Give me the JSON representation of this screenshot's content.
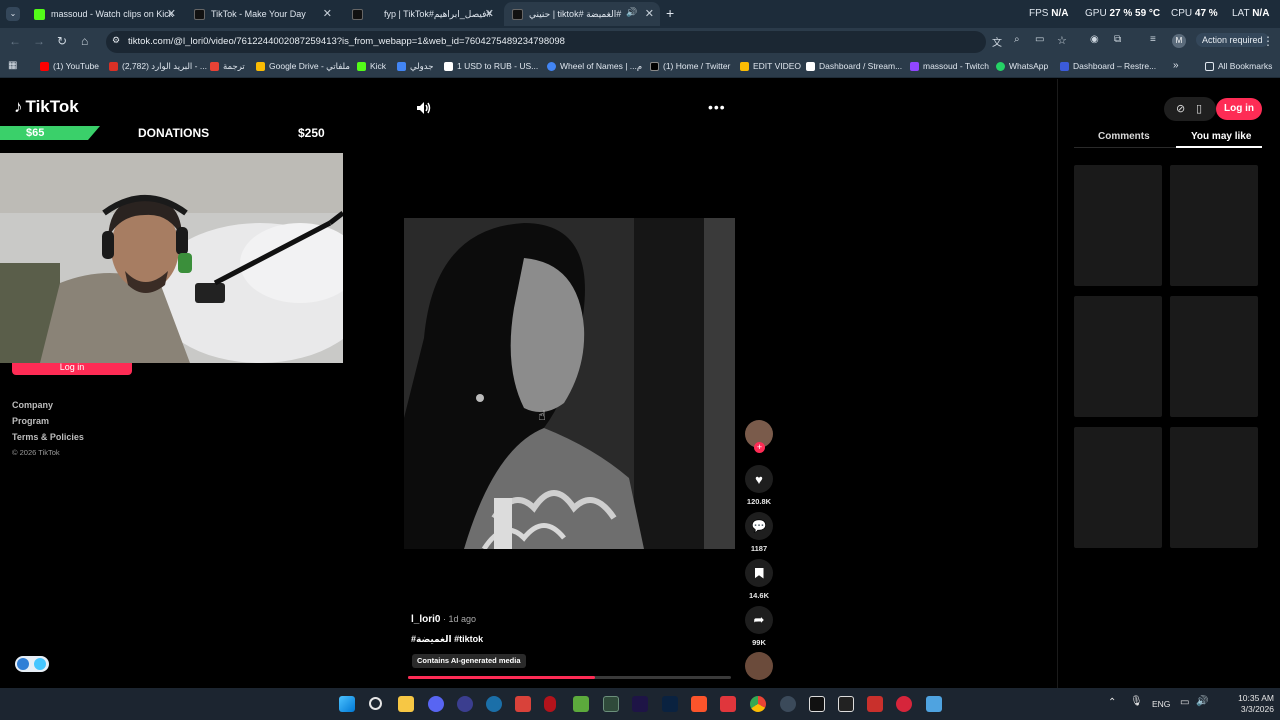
{
  "browser": {
    "tabs": [
      {
        "title": "massoud - Watch clips on Kick",
        "color": "#53fc18"
      },
      {
        "title": "TikTok - Make Your Day",
        "color": "#111111"
      },
      {
        "title": "",
        "color": "#111111"
      },
      {
        "title": "fyp | TikTok#فيصل_ابراهيم#",
        "color": "#111111"
      },
      {
        "title": "حنيني | tiktok# الغميضة#",
        "color": "#111111"
      }
    ],
    "new_tab": "+",
    "stats": {
      "fps_label": "FPS",
      "fps_value": "N/A",
      "gpu_label": "GPU",
      "gpu_value": "27 % 59 °C",
      "cpu_label": "CPU",
      "cpu_value": "47 %",
      "lat_label": "LAT",
      "lat_value": "N/A"
    },
    "url": "tiktok.com/@l_lori0/video/7612244002087259413?is_from_webapp=1&web_id=7604275489234798098",
    "action_required": "Action required",
    "bookmarks": [
      {
        "label": "(1) YouTube",
        "color": "#ff0000"
      },
      {
        "label": "(2,782) البريد الوارد - ...",
        "color": "#d93025"
      },
      {
        "label": "ترجمة",
        "color": "#e94235"
      },
      {
        "label": "Google Drive - ملفاتي",
        "color": "#fbbc04"
      },
      {
        "label": "Kick",
        "color": "#53fc18"
      },
      {
        "label": "جدولي",
        "color": "#4285f4"
      },
      {
        "label": "1 USD to RUB - US...",
        "color": "#ffffff"
      },
      {
        "label": "Wheel of Names | ...م",
        "color": "#4285f4"
      },
      {
        "label": "(1) Home / Twitter",
        "color": "#000000"
      },
      {
        "label": "EDIT VIDEO",
        "color": "#fbbc04"
      },
      {
        "label": "Dashboard / Stream...",
        "color": "#ffffff"
      },
      {
        "label": "massoud - Twitch",
        "color": "#9146ff"
      },
      {
        "label": "WhatsApp",
        "color": "#25d366"
      },
      {
        "label": "Dashboard – Restre...",
        "color": "#3b5bdb"
      }
    ],
    "all_bookmarks": "All Bookmarks"
  },
  "tiktok": {
    "logo": "TikTok",
    "donation": {
      "amount": "$65",
      "title": "DONATIONS",
      "goal": "$250",
      "progress": 0.26
    },
    "left_login": "Log in",
    "footer": [
      "Company",
      "Program",
      "Terms & Policies"
    ],
    "copyright": "© 2026 TikTok",
    "video": {
      "author": "l_lori0",
      "ago": " · 1d ago",
      "tags": "#الغميضة #tiktok",
      "ai_badge": "Contains AI-generated media",
      "progress": 0.58
    },
    "actions": {
      "likes": "120.8K",
      "comments": "1187",
      "saves": "14.6K",
      "shares": "99K"
    },
    "right": {
      "login": "Log in",
      "tab_comments": "Comments",
      "tab_you_may_like": "You may like"
    }
  },
  "taskbar": {
    "lang": "ENG",
    "time": "10:35 AM",
    "date": "3/3/2026"
  },
  "colors": {
    "accent": "#fe2c55",
    "donation": "#3ad06a"
  }
}
